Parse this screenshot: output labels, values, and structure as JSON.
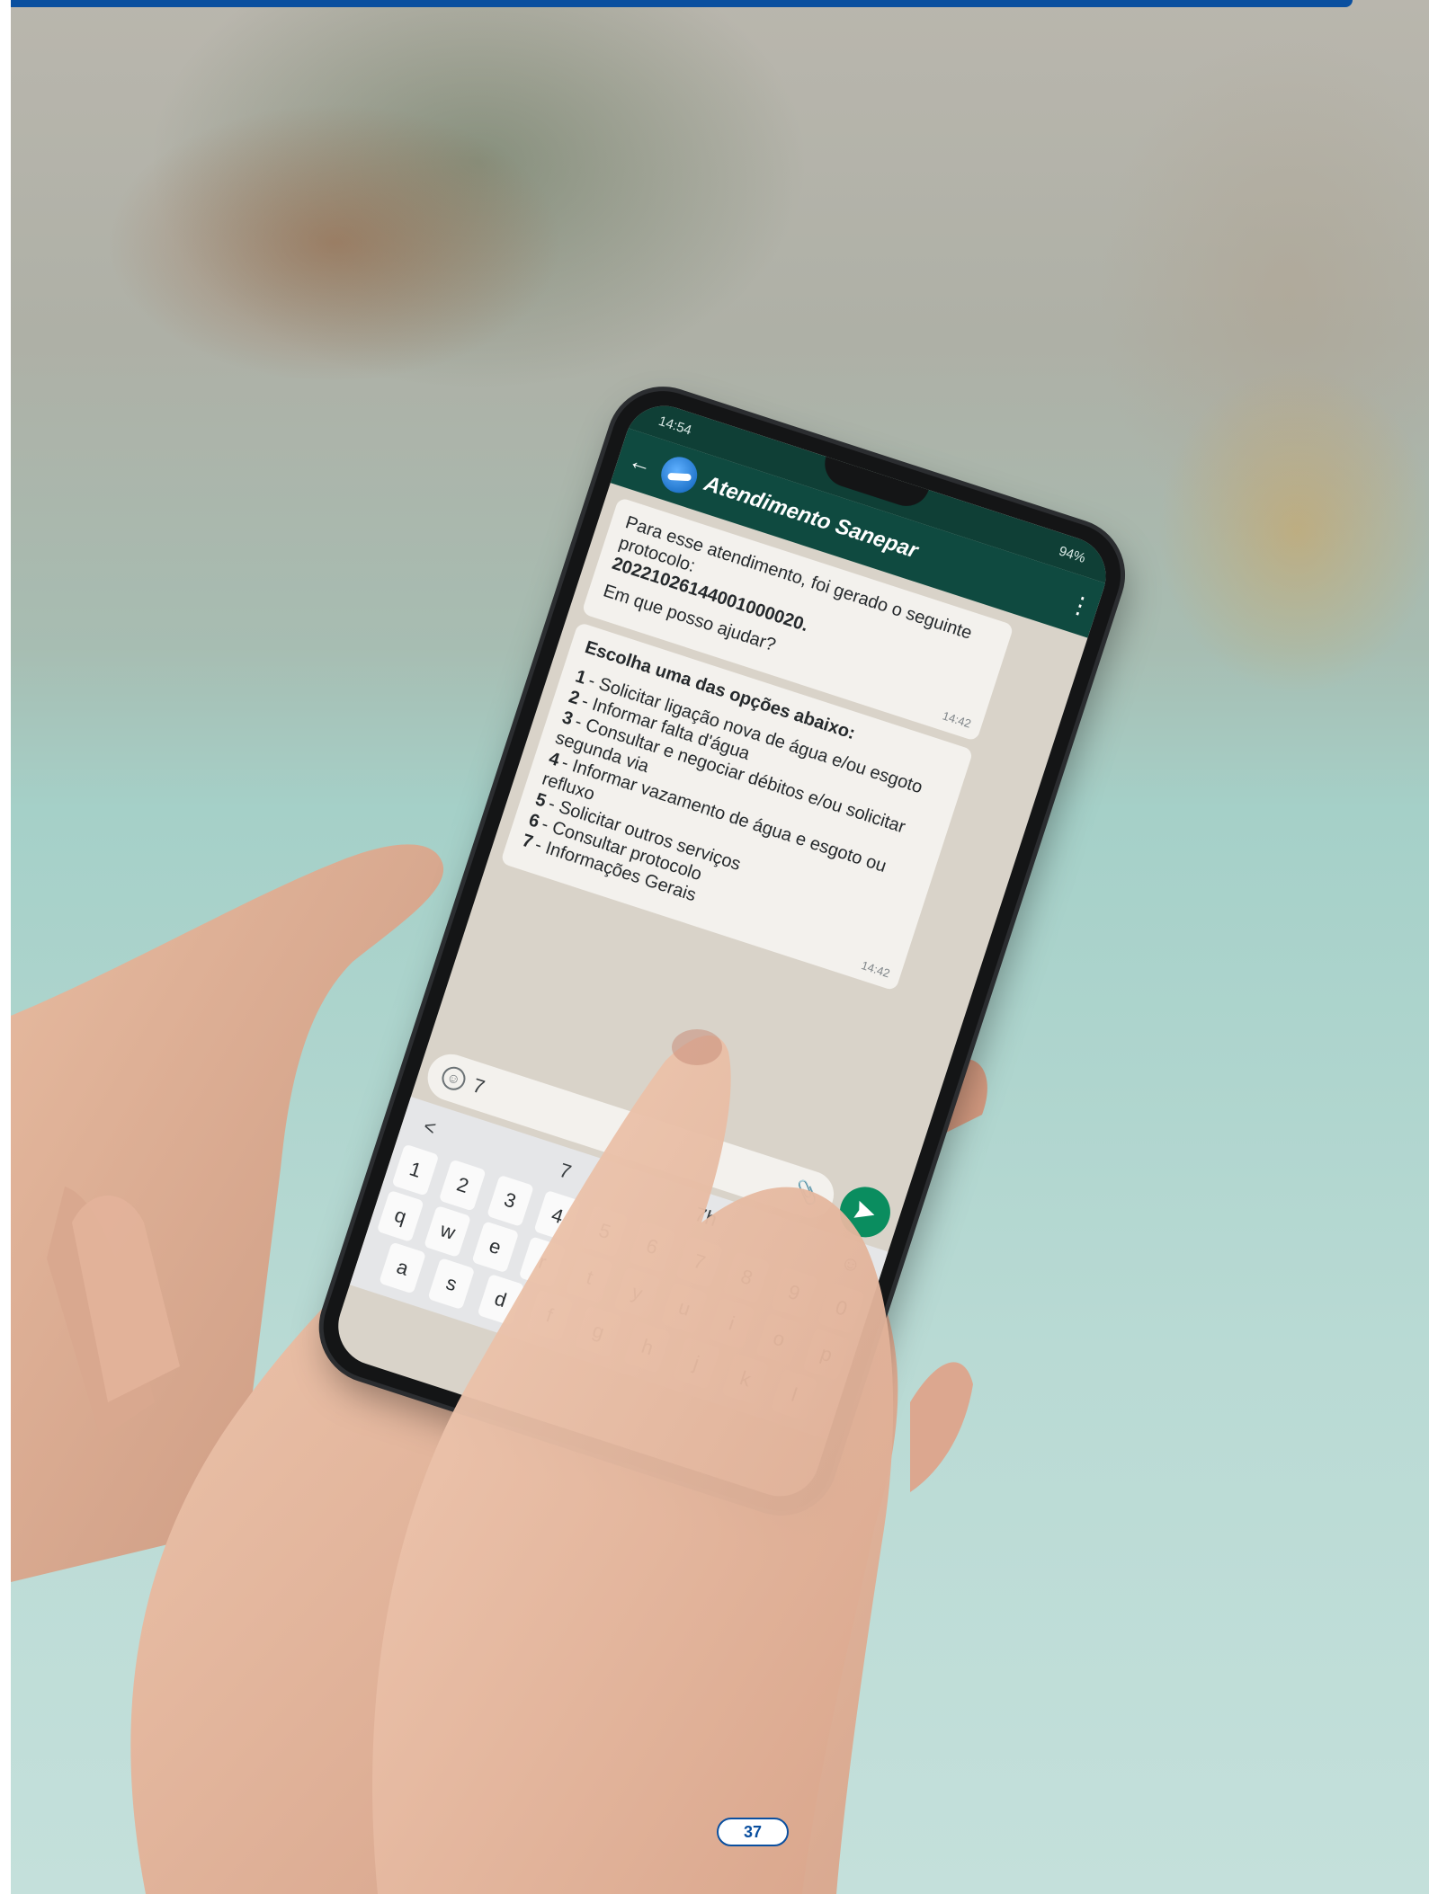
{
  "page": {
    "number": "37"
  },
  "colors": {
    "brand_blue": "#0a4f9f",
    "whatsapp_dark_green": "#0f4a40",
    "send_green": "#0a8d5f"
  },
  "phone": {
    "status_bar": {
      "time": "14:54",
      "battery": "94%"
    },
    "header": {
      "title": "Atendimento Sanepar",
      "back_icon": "back-arrow-icon",
      "menu_icon": "more-vertical-icon"
    },
    "messages": {
      "first": {
        "line1": "Para esse atendimento, foi gerado o seguinte protocolo:",
        "protocol": "20221026144001000020.",
        "line2": "Em que posso ajudar?",
        "time": "14:42"
      },
      "second": {
        "heading": "Escolha uma das opções abaixo:",
        "options": [
          {
            "num": "1",
            "text": "- Solicitar ligação nova de água e/ou esgoto"
          },
          {
            "num": "2",
            "text": "- Informar falta d'água"
          },
          {
            "num": "3",
            "text": "- Consultar e negociar débitos e/ou solicitar segunda via"
          },
          {
            "num": "4",
            "text": "- Informar vazamento de água e esgoto ou refluxo"
          },
          {
            "num": "5",
            "text": "- Solicitar outros serviços"
          },
          {
            "num": "6",
            "text": "- Consultar protocolo"
          },
          {
            "num": "7",
            "text": "- Informações Gerais"
          }
        ],
        "time": "14:42"
      }
    },
    "input": {
      "value": "7"
    },
    "keyboard": {
      "suggestions": [
        "<",
        "7",
        "7h"
      ],
      "number_row": [
        "1",
        "2",
        "3",
        "4",
        "5",
        "6",
        "7",
        "8",
        "9",
        "0"
      ],
      "row1": [
        "q",
        "w",
        "e",
        "r",
        "t",
        "y",
        "u",
        "i",
        "o",
        "p"
      ],
      "row2": [
        "a",
        "s",
        "d",
        "f",
        "g",
        "h",
        "j",
        "k",
        "l"
      ]
    }
  }
}
